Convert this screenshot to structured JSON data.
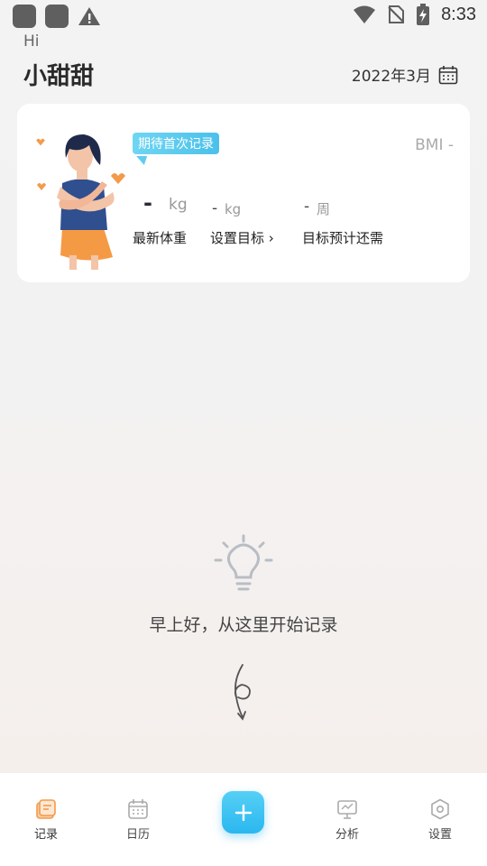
{
  "status_bar": {
    "time": "8:33"
  },
  "header": {
    "greeting": "Hi",
    "user_name": "小甜甜",
    "month": "2022年3月"
  },
  "card": {
    "badge": "期待首次记录",
    "bmi": "BMI -",
    "latest_weight": {
      "value": "-",
      "unit": "kg",
      "label": "最新体重"
    },
    "target": {
      "value": "-",
      "unit": "kg",
      "label": "设置目标",
      "chevron": "›"
    },
    "eta": {
      "value": "-",
      "unit": "周",
      "label": "目标预计还需"
    }
  },
  "empty_state": {
    "message": "早上好，从这里开始记录"
  },
  "bottom_nav": {
    "items": [
      {
        "label": "记录",
        "icon": "record-icon",
        "active": true
      },
      {
        "label": "日历",
        "icon": "calendar-icon"
      },
      {
        "label": "分析",
        "icon": "analysis-icon"
      },
      {
        "label": "设置",
        "icon": "settings-icon"
      }
    ],
    "add_icon": "plus-icon"
  },
  "colors": {
    "accent": "#3cc1ef",
    "active_nav": "#f39a4b",
    "background": "#f3f3f3"
  }
}
